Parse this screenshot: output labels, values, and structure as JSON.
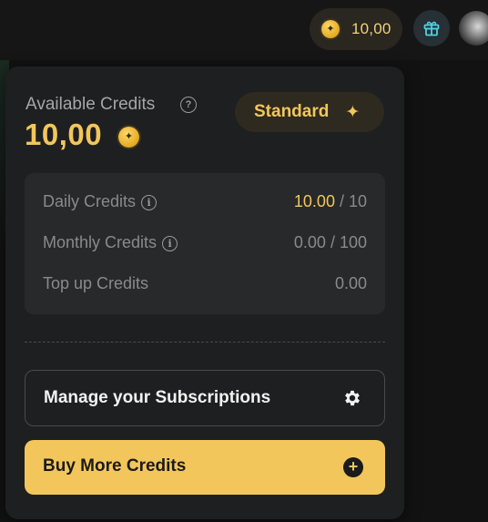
{
  "header": {
    "credit_balance": "10,00",
    "coin_icon": "coin-star-icon",
    "gift_icon": "gift-icon",
    "avatar_icon": "user-avatar"
  },
  "credits_panel": {
    "available_label": "Available Credits",
    "available_value": "10,00",
    "plan_badge": "Standard",
    "breakdown": [
      {
        "label": "Daily Credits",
        "current": "10.00",
        "separator": " / ",
        "total": "10",
        "has_info": true,
        "highlight": true
      },
      {
        "label": "Monthly Credits",
        "current": "0.00",
        "separator": " / ",
        "total": "100",
        "has_info": true,
        "highlight": false
      },
      {
        "label": "Top up Credits",
        "current": "0.00",
        "separator": "",
        "total": "",
        "has_info": false,
        "highlight": false
      }
    ],
    "manage_button": "Manage your Subscriptions",
    "buy_button": "Buy More Credits"
  },
  "colors": {
    "accent": "#f3c65b",
    "background": "#121212",
    "panel": "#1e1f20",
    "breakdown_bg": "#27292a",
    "muted_text": "#8a8a8a"
  }
}
